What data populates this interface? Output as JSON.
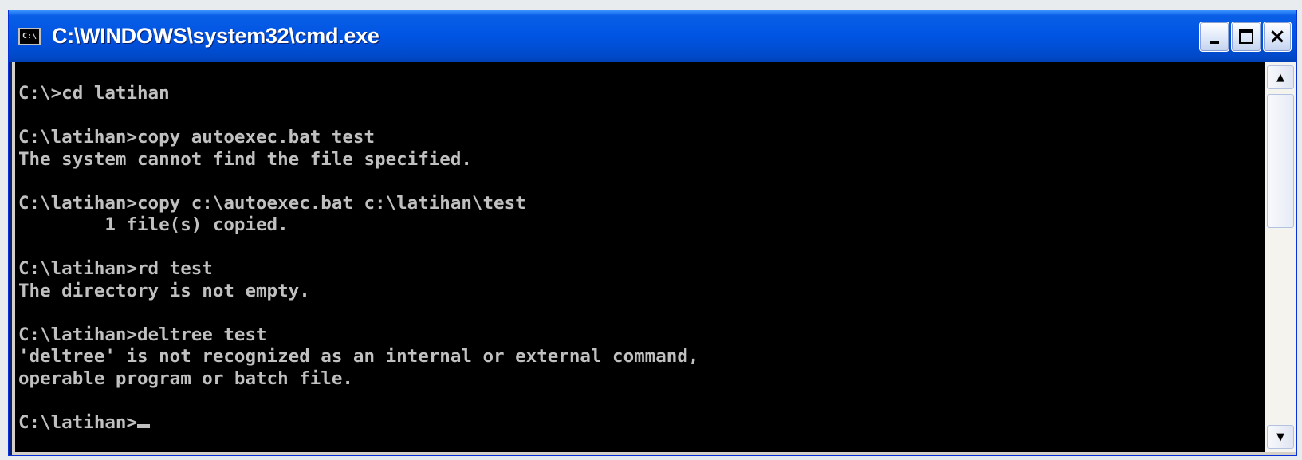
{
  "window": {
    "title": "C:\\WINDOWS\\system32\\cmd.exe",
    "icon": "cmd-app-icon",
    "icon_text": "C:\\"
  },
  "controls": {
    "minimize_icon": "minimize-icon",
    "maximize_icon": "maximize-icon",
    "close_icon": "close-icon",
    "close_glyph": "×"
  },
  "console": {
    "lines": [
      "C:\\>cd latihan",
      "",
      "C:\\latihan>copy autoexec.bat test",
      "The system cannot find the file specified.",
      "",
      "C:\\latihan>copy c:\\autoexec.bat c:\\latihan\\test",
      "        1 file(s) copied.",
      "",
      "C:\\latihan>rd test",
      "The directory is not empty.",
      "",
      "C:\\latihan>deltree test",
      "'deltree' is not recognized as an internal or external command,",
      "operable program or batch file.",
      "",
      "C:\\latihan>"
    ],
    "text_color": "#c0c0c0",
    "background": "#000000"
  },
  "scrollbar": {
    "up_glyph": "▲",
    "down_glyph": "▼"
  },
  "colors": {
    "titlebar": "#0054e3",
    "title_text": "#ffffff"
  }
}
